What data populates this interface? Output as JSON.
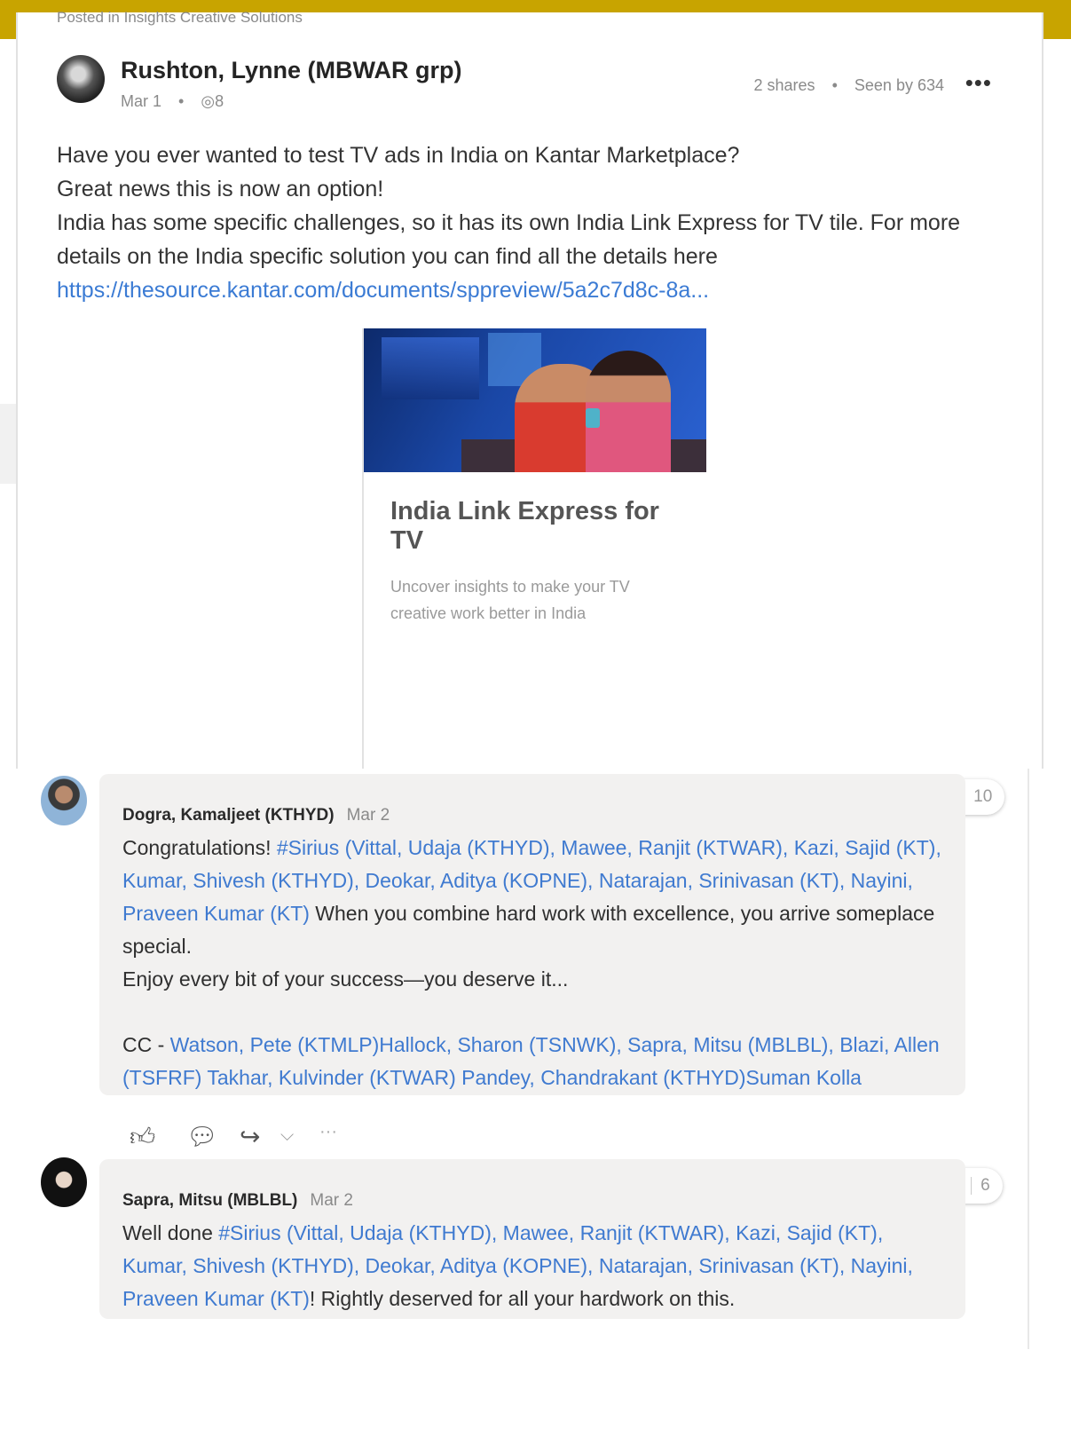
{
  "post": {
    "posted_in": "Posted in Insights Creative Solutions",
    "author": "Rushton, Lynne (MBWAR grp)",
    "date": "Mar 1",
    "views_icon_label": "8",
    "shares": "2 shares",
    "seen_by": "Seen by 634",
    "lines": [
      "Have you ever wanted to test TV ads in India on Kantar Marketplace?",
      "Great news this is now an option!",
      "India has some specific challenges, so it has its own India Link Express for TV tile. For more details on the India specific solution you can find all the details here"
    ],
    "link": "https://thesource.kantar.com/documents/sppreview/5a2c7d8c-8a...",
    "card": {
      "title": "India Link Express for TV",
      "description": "Uncover insights to make your TV creative work better in India"
    }
  },
  "comments": [
    {
      "author": "Dogra, Kamaljeet (KTHYD)",
      "date": "Mar 2",
      "reaction_count": "10",
      "t1": "Congratulations! ",
      "m1": "#Sirius",
      "t2": " ",
      "m2": "(Vittal, Udaja (KTHYD), Mawee, Ranjit (KTWAR), Kazi, Sajid (KT), Kumar, Shivesh (KTHYD), Deokar, Aditya (KOPNE), Natarajan, Srinivasan (KT), Nayini, Praveen Kumar (KT)",
      "t3": " When you combine hard work with excellence, you arrive someplace special.",
      "line2": "Enjoy every bit of your success—you deserve it...",
      "cc_prefix": "CC - ",
      "cc_mentions": "Watson, Pete (KTMLP)Hallock, Sharon (TSNWK), Sapra, Mitsu (MBLBL), Blazi, Allen (TSFRF) Takhar, Kulvinder (KTWAR) Pandey, Chandrakant (KTHYD)Suman Kolla"
    },
    {
      "author": "Sapra, Mitsu (MBLBL)",
      "date": "Mar 2",
      "reaction_count": "6",
      "t1": "Well done ",
      "m1": "#Sirius",
      "t2": " ",
      "m2": "(Vittal, Udaja (KTHYD), Mawee, Ranjit (KTWAR), Kazi, Sajid (KT), Kumar, Shivesh (KTHYD), Deokar, Aditya (KOPNE), Natarajan, Srinivasan (KT), Nayini, Praveen Kumar (KT)",
      "t3": "! Rightly deserved for all your hardwork on this."
    }
  ],
  "colors": {
    "accent_bar": "#c8a400",
    "link": "#3f7ad0",
    "heart": "#e0242d",
    "thumb": "#f1b32a"
  },
  "icons": [
    "eye-icon",
    "more-options-icon",
    "heart-icon",
    "thumbs-up-icon",
    "mention-icon",
    "like-icon",
    "reply-icon",
    "share-icon",
    "chevron-down-icon"
  ]
}
